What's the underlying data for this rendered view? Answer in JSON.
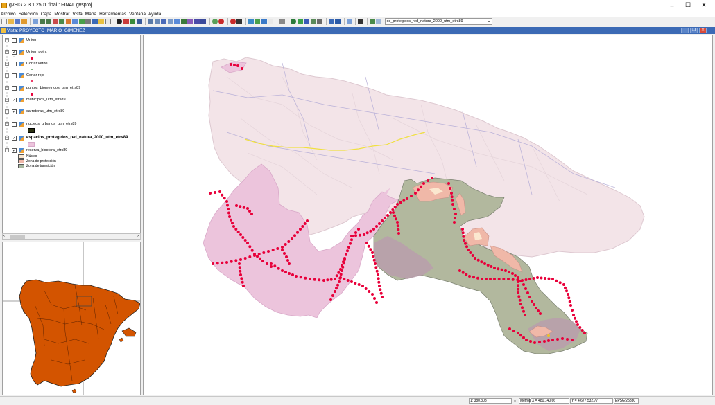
{
  "window": {
    "title": "gvSIG 2.3.1.2501 final : FINAL.gvsproj",
    "minimize": "–",
    "maximize": "☐",
    "close": "✕"
  },
  "menu": [
    "Archivo",
    "Selección",
    "Capa",
    "Mostrar",
    "Vista",
    "Mapa",
    "Herramientas",
    "Ventana",
    "Ayuda"
  ],
  "toolbar": {
    "active_layer": "os_protegidos_red_natura_2000_utm_etrs89"
  },
  "view": {
    "title": "Vista: PROYECTO_MARIO_GIMENEZ"
  },
  "toc": {
    "layers": [
      {
        "name": "Union",
        "checked": false,
        "bold": false
      },
      {
        "name": "Union_point",
        "checked": true,
        "bold": false
      },
      {
        "name": "Cortar verde",
        "checked": false,
        "bold": false
      },
      {
        "name": "Cortar rojo",
        "checked": false,
        "bold": false
      },
      {
        "name": "puntos_biometricos_utm_etrs89",
        "checked": false,
        "bold": false
      },
      {
        "name": "municipios_utm_etrs89",
        "checked": true,
        "bold": false
      },
      {
        "name": "carreteras_utm_etrs89",
        "checked": true,
        "bold": false
      },
      {
        "name": "nucleos_urbanos_utm_etrs89",
        "checked": false,
        "bold": false
      },
      {
        "name": "espacios_protegidos_red_natura_2000_utm_etrs89",
        "checked": true,
        "bold": true
      },
      {
        "name": "reserva_biosfera_etrs89",
        "checked": true,
        "bold": false
      }
    ],
    "legend": [
      {
        "label": "Núcleo",
        "color": "#fbe7cf"
      },
      {
        "label": "Zona de protección",
        "color": "#f0b8a8"
      },
      {
        "label": "Zona de transición",
        "color": "#a8b8a0"
      }
    ]
  },
  "status": {
    "scale": "1: 380.308",
    "units": "Metros",
    "x": "X = 480.140,66",
    "y": "Y = 4.677.532,77",
    "crs": "EPSG:25830"
  },
  "colors": {
    "region": "#f3e4e8",
    "natura": "#ecc4dc",
    "transition": "#b2b89e",
    "protection": "#f0b8a8",
    "core": "#fbe7cf",
    "points": "#e8003a",
    "spain": "#d35400",
    "title": "#3c6ab5"
  }
}
